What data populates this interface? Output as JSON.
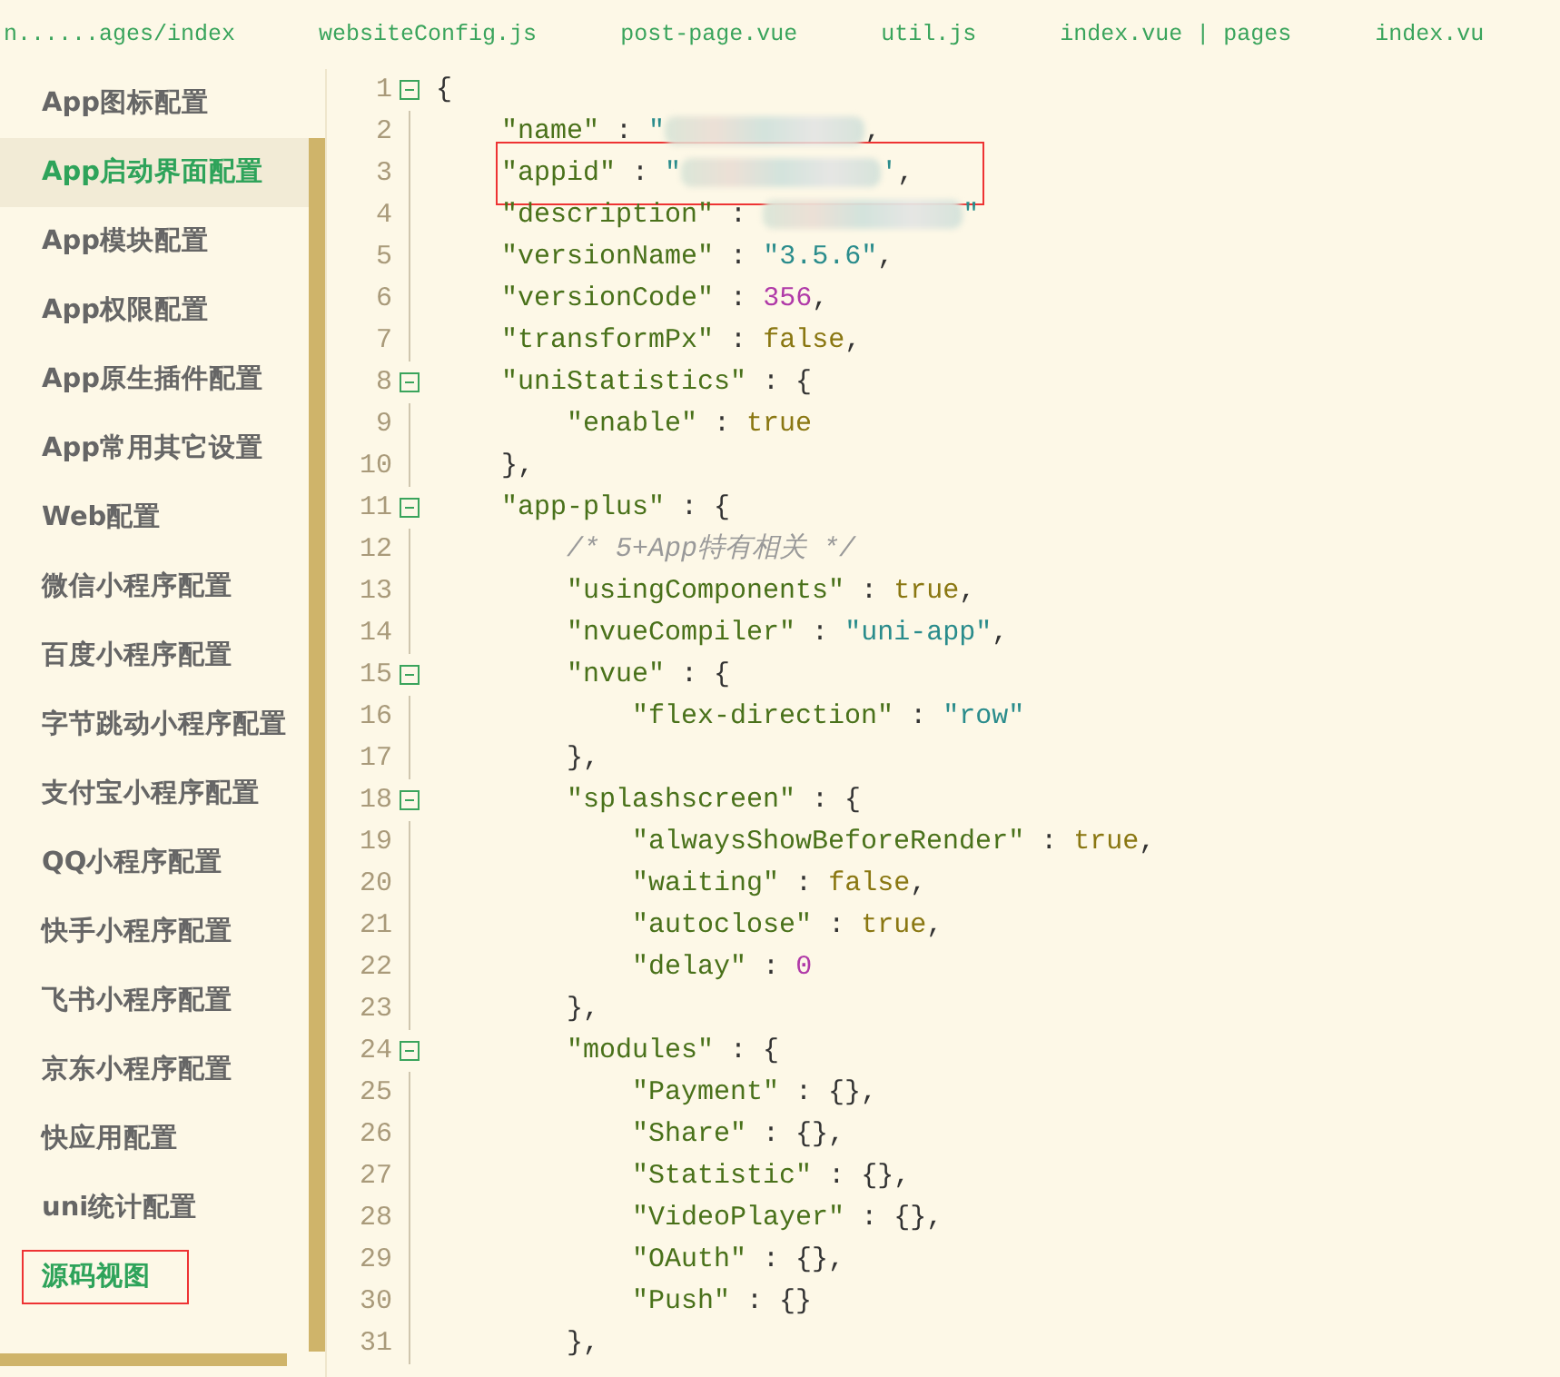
{
  "tabs": [
    {
      "label": "n......ages/index"
    },
    {
      "label": "websiteConfig.js"
    },
    {
      "label": "post-page.vue"
    },
    {
      "label": "util.js"
    },
    {
      "label": "index.vue | pages"
    },
    {
      "label": "index.vu"
    }
  ],
  "sidebar": {
    "items": [
      {
        "label": "App图标配置",
        "selected": false,
        "boxed": false
      },
      {
        "label": "App启动界面配置",
        "selected": true,
        "boxed": false
      },
      {
        "label": "App模块配置",
        "selected": false,
        "boxed": false
      },
      {
        "label": "App权限配置",
        "selected": false,
        "boxed": false
      },
      {
        "label": "App原生插件配置",
        "selected": false,
        "boxed": false
      },
      {
        "label": "App常用其它设置",
        "selected": false,
        "boxed": false
      },
      {
        "label": "Web配置",
        "selected": false,
        "boxed": false
      },
      {
        "label": "微信小程序配置",
        "selected": false,
        "boxed": false
      },
      {
        "label": "百度小程序配置",
        "selected": false,
        "boxed": false
      },
      {
        "label": "字节跳动小程序配置",
        "selected": false,
        "boxed": false
      },
      {
        "label": "支付宝小程序配置",
        "selected": false,
        "boxed": false
      },
      {
        "label": "QQ小程序配置",
        "selected": false,
        "boxed": false
      },
      {
        "label": "快手小程序配置",
        "selected": false,
        "boxed": false
      },
      {
        "label": "飞书小程序配置",
        "selected": false,
        "boxed": false
      },
      {
        "label": "京东小程序配置",
        "selected": false,
        "boxed": false
      },
      {
        "label": "快应用配置",
        "selected": false,
        "boxed": false
      },
      {
        "label": "uni统计配置",
        "selected": false,
        "boxed": false
      },
      {
        "label": "源码视图",
        "selected": false,
        "boxed": true
      }
    ]
  },
  "editor": {
    "lines": [
      {
        "number": "1",
        "fold": true,
        "boxed": false,
        "tokens": [
          {
            "kind": "punct",
            "text": "{"
          }
        ]
      },
      {
        "number": "2",
        "fold": false,
        "boxed": false,
        "tokens": [
          {
            "kind": "key",
            "text": "    \"name\""
          },
          {
            "kind": "punct",
            "text": " : "
          },
          {
            "kind": "string",
            "text": "\""
          },
          {
            "kind": "redacted"
          },
          {
            "kind": "punct",
            "text": ","
          }
        ]
      },
      {
        "number": "3",
        "fold": false,
        "boxed": true,
        "tokens": [
          {
            "kind": "key",
            "text": "    \"appid\""
          },
          {
            "kind": "punct",
            "text": " : "
          },
          {
            "kind": "string",
            "text": "\""
          },
          {
            "kind": "redacted"
          },
          {
            "kind": "string",
            "text": "'"
          },
          {
            "kind": "punct",
            "text": ","
          }
        ]
      },
      {
        "number": "4",
        "fold": false,
        "boxed": false,
        "tokens": [
          {
            "kind": "key",
            "text": "    \"description\""
          },
          {
            "kind": "punct",
            "text": " : "
          },
          {
            "kind": "redacted"
          },
          {
            "kind": "string",
            "text": "\""
          }
        ]
      },
      {
        "number": "5",
        "fold": false,
        "boxed": false,
        "tokens": [
          {
            "kind": "key",
            "text": "    \"versionName\""
          },
          {
            "kind": "punct",
            "text": " : "
          },
          {
            "kind": "string",
            "text": "\"3.5.6\""
          },
          {
            "kind": "punct",
            "text": ","
          }
        ]
      },
      {
        "number": "6",
        "fold": false,
        "boxed": false,
        "tokens": [
          {
            "kind": "key",
            "text": "    \"versionCode\""
          },
          {
            "kind": "punct",
            "text": " : "
          },
          {
            "kind": "number",
            "text": "356"
          },
          {
            "kind": "punct",
            "text": ","
          }
        ]
      },
      {
        "number": "7",
        "fold": false,
        "boxed": false,
        "tokens": [
          {
            "kind": "key",
            "text": "    \"transformPx\""
          },
          {
            "kind": "punct",
            "text": " : "
          },
          {
            "kind": "bool",
            "text": "false"
          },
          {
            "kind": "punct",
            "text": ","
          }
        ]
      },
      {
        "number": "8",
        "fold": true,
        "boxed": false,
        "tokens": [
          {
            "kind": "key",
            "text": "    \"uniStatistics\""
          },
          {
            "kind": "punct",
            "text": " : {"
          }
        ]
      },
      {
        "number": "9",
        "fold": false,
        "boxed": false,
        "tokens": [
          {
            "kind": "key",
            "text": "        \"enable\""
          },
          {
            "kind": "punct",
            "text": " : "
          },
          {
            "kind": "bool",
            "text": "true"
          }
        ]
      },
      {
        "number": "10",
        "fold": false,
        "boxed": false,
        "tokens": [
          {
            "kind": "punct",
            "text": "    },"
          }
        ]
      },
      {
        "number": "11",
        "fold": true,
        "boxed": false,
        "tokens": [
          {
            "kind": "key",
            "text": "    \"app-plus\""
          },
          {
            "kind": "punct",
            "text": " : {"
          }
        ]
      },
      {
        "number": "12",
        "fold": false,
        "boxed": false,
        "tokens": [
          {
            "kind": "comment",
            "text": "        /* 5+App特有相关 */"
          }
        ]
      },
      {
        "number": "13",
        "fold": false,
        "boxed": false,
        "tokens": [
          {
            "kind": "key",
            "text": "        \"usingComponents\""
          },
          {
            "kind": "punct",
            "text": " : "
          },
          {
            "kind": "bool",
            "text": "true"
          },
          {
            "kind": "punct",
            "text": ","
          }
        ]
      },
      {
        "number": "14",
        "fold": false,
        "boxed": false,
        "tokens": [
          {
            "kind": "key",
            "text": "        \"nvueCompiler\""
          },
          {
            "kind": "punct",
            "text": " : "
          },
          {
            "kind": "string",
            "text": "\"uni-app\""
          },
          {
            "kind": "punct",
            "text": ","
          }
        ]
      },
      {
        "number": "15",
        "fold": true,
        "boxed": false,
        "tokens": [
          {
            "kind": "key",
            "text": "        \"nvue\""
          },
          {
            "kind": "punct",
            "text": " : {"
          }
        ]
      },
      {
        "number": "16",
        "fold": false,
        "boxed": false,
        "tokens": [
          {
            "kind": "key",
            "text": "            \"flex-direction\""
          },
          {
            "kind": "punct",
            "text": " : "
          },
          {
            "kind": "string",
            "text": "\"row\""
          }
        ]
      },
      {
        "number": "17",
        "fold": false,
        "boxed": false,
        "tokens": [
          {
            "kind": "punct",
            "text": "        },"
          }
        ]
      },
      {
        "number": "18",
        "fold": true,
        "boxed": false,
        "tokens": [
          {
            "kind": "key",
            "text": "        \"splashscreen\""
          },
          {
            "kind": "punct",
            "text": " : {"
          }
        ]
      },
      {
        "number": "19",
        "fold": false,
        "boxed": false,
        "tokens": [
          {
            "kind": "key",
            "text": "            \"alwaysShowBeforeRender\""
          },
          {
            "kind": "punct",
            "text": " : "
          },
          {
            "kind": "bool",
            "text": "true"
          },
          {
            "kind": "punct",
            "text": ","
          }
        ]
      },
      {
        "number": "20",
        "fold": false,
        "boxed": false,
        "tokens": [
          {
            "kind": "key",
            "text": "            \"waiting\""
          },
          {
            "kind": "punct",
            "text": " : "
          },
          {
            "kind": "bool",
            "text": "false"
          },
          {
            "kind": "punct",
            "text": ","
          }
        ]
      },
      {
        "number": "21",
        "fold": false,
        "boxed": false,
        "tokens": [
          {
            "kind": "key",
            "text": "            \"autoclose\""
          },
          {
            "kind": "punct",
            "text": " : "
          },
          {
            "kind": "bool",
            "text": "true"
          },
          {
            "kind": "punct",
            "text": ","
          }
        ]
      },
      {
        "number": "22",
        "fold": false,
        "boxed": false,
        "tokens": [
          {
            "kind": "key",
            "text": "            \"delay\""
          },
          {
            "kind": "punct",
            "text": " : "
          },
          {
            "kind": "number",
            "text": "0"
          }
        ]
      },
      {
        "number": "23",
        "fold": false,
        "boxed": false,
        "tokens": [
          {
            "kind": "punct",
            "text": "        },"
          }
        ]
      },
      {
        "number": "24",
        "fold": true,
        "boxed": false,
        "tokens": [
          {
            "kind": "key",
            "text": "        \"modules\""
          },
          {
            "kind": "punct",
            "text": " : {"
          }
        ]
      },
      {
        "number": "25",
        "fold": false,
        "boxed": false,
        "tokens": [
          {
            "kind": "key",
            "text": "            \"Payment\""
          },
          {
            "kind": "punct",
            "text": " : {},"
          }
        ]
      },
      {
        "number": "26",
        "fold": false,
        "boxed": false,
        "tokens": [
          {
            "kind": "key",
            "text": "            \"Share\""
          },
          {
            "kind": "punct",
            "text": " : {},"
          }
        ]
      },
      {
        "number": "27",
        "fold": false,
        "boxed": false,
        "tokens": [
          {
            "kind": "key",
            "text": "            \"Statistic\""
          },
          {
            "kind": "punct",
            "text": " : {},"
          }
        ]
      },
      {
        "number": "28",
        "fold": false,
        "boxed": false,
        "tokens": [
          {
            "kind": "key",
            "text": "            \"VideoPlayer\""
          },
          {
            "kind": "punct",
            "text": " : {},"
          }
        ]
      },
      {
        "number": "29",
        "fold": false,
        "boxed": false,
        "tokens": [
          {
            "kind": "key",
            "text": "            \"OAuth\""
          },
          {
            "kind": "punct",
            "text": " : {},"
          }
        ]
      },
      {
        "number": "30",
        "fold": false,
        "boxed": false,
        "tokens": [
          {
            "kind": "key",
            "text": "            \"Push\""
          },
          {
            "kind": "punct",
            "text": " : {}"
          }
        ]
      },
      {
        "number": "31",
        "fold": false,
        "boxed": false,
        "tokens": [
          {
            "kind": "punct",
            "text": "        },"
          }
        ]
      }
    ]
  }
}
